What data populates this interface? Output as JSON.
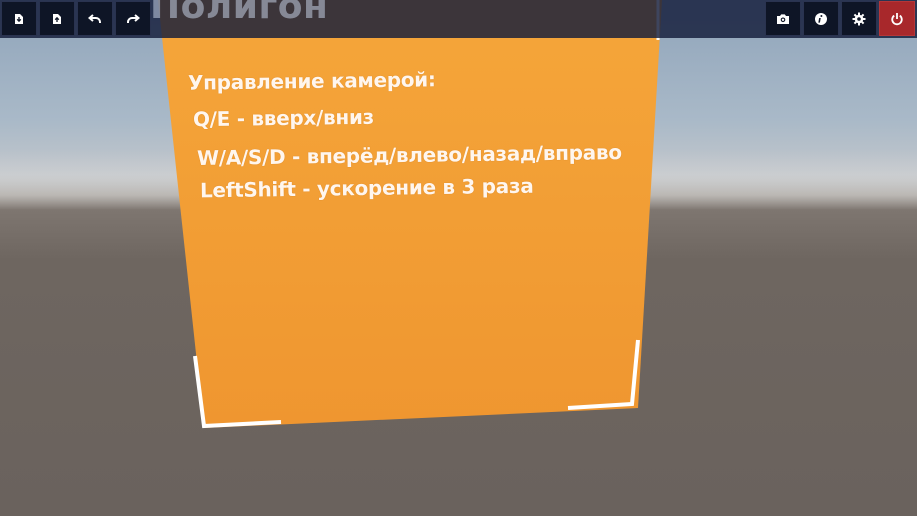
{
  "hud": {
    "title": "Полигон",
    "left_buttons": [
      {
        "name": "save-download-button",
        "icon": "download-icon"
      },
      {
        "name": "load-upload-button",
        "icon": "upload-icon"
      },
      {
        "name": "undo-button",
        "icon": "undo-icon"
      },
      {
        "name": "redo-button",
        "icon": "redo-icon"
      }
    ],
    "right_buttons": [
      {
        "name": "screenshot-button",
        "icon": "camera-icon"
      },
      {
        "name": "info-button",
        "icon": "info-icon"
      },
      {
        "name": "settings-button",
        "icon": "gear-icon"
      },
      {
        "name": "power-button",
        "icon": "power-icon"
      }
    ],
    "colors": {
      "bar": "#141c3a",
      "button": "#0e1526",
      "power": "#a8282b"
    }
  },
  "board": {
    "color": "#f39a2e",
    "lines": [
      "Управление камерой:",
      "Q/E - вверх/вниз",
      "W/A/S/D - вперёд/влево/назад/вправо",
      "LeftShift - ускорение в 3 раза"
    ]
  }
}
